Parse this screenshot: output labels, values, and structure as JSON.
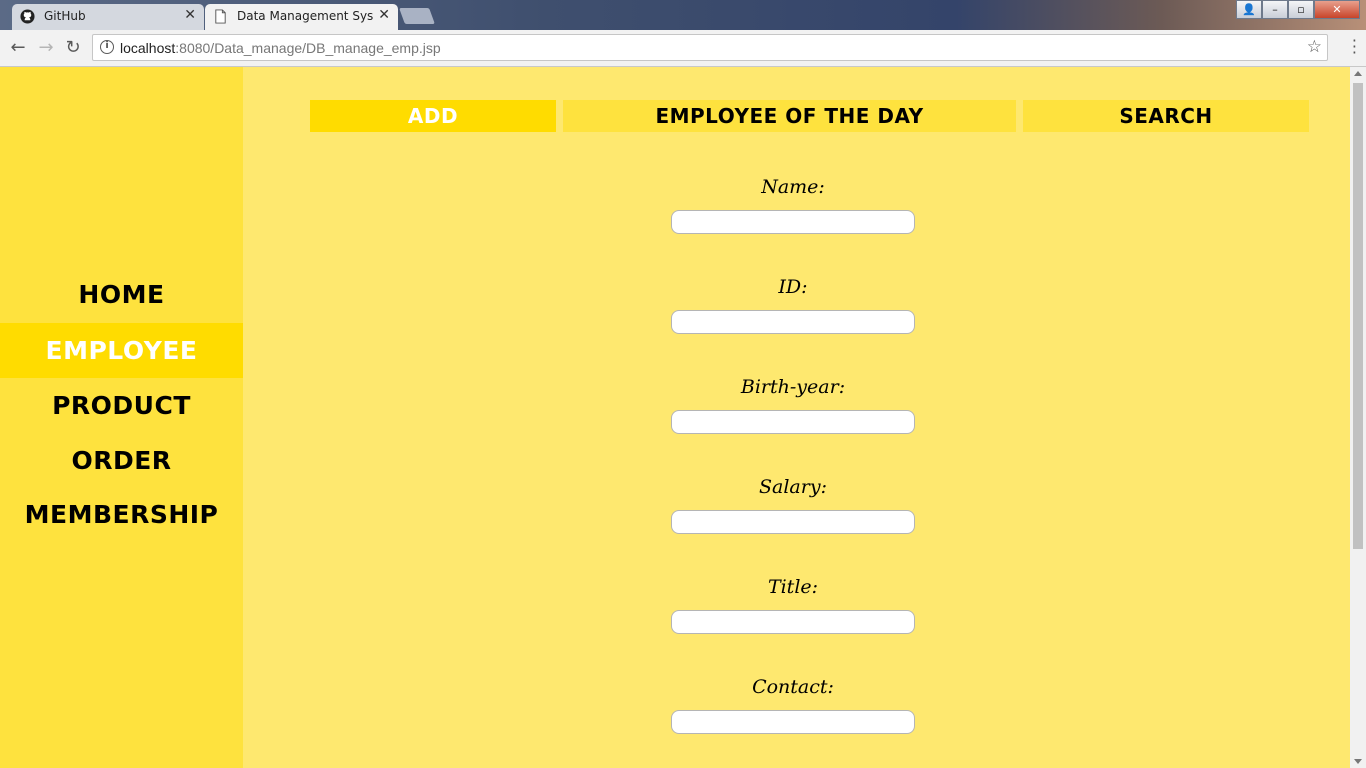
{
  "browser": {
    "tabs": [
      {
        "title": "GitHub",
        "icon": "github-icon",
        "close": "✕"
      },
      {
        "title": "Data Management Syst",
        "icon": "page-icon",
        "close": "✕"
      }
    ],
    "url_host": "localhost",
    "url_rest": ":8080/Data_manage/DB_manage_emp.jsp",
    "back_glyph": "←",
    "forward_glyph": "→",
    "reload_glyph": "↻",
    "star_glyph": "☆",
    "info_glyph": "i",
    "min_glyph": "–",
    "max_glyph": "▫",
    "close_glyph": "✕"
  },
  "sidebar": {
    "items": [
      {
        "label": "HOME",
        "active": false
      },
      {
        "label": "EMPLOYEE",
        "active": true
      },
      {
        "label": "PRODUCT",
        "active": false
      },
      {
        "label": "ORDER",
        "active": false
      },
      {
        "label": "MEMBERSHIP",
        "active": false
      }
    ]
  },
  "tabs": {
    "add": "ADD",
    "employee_of_the_day": "EMPLOYEE OF THE DAY",
    "search": "SEARCH"
  },
  "form": {
    "fields": [
      {
        "label": "Name:",
        "value": ""
      },
      {
        "label": "ID:",
        "value": ""
      },
      {
        "label": "Birth-year:",
        "value": ""
      },
      {
        "label": "Salary:",
        "value": ""
      },
      {
        "label": "Title:",
        "value": ""
      },
      {
        "label": "Contact:",
        "value": ""
      }
    ]
  },
  "colors": {
    "page_bg": "#fee86f",
    "sidebar_bg": "#fee23e",
    "active_bg": "#ffdc00"
  }
}
